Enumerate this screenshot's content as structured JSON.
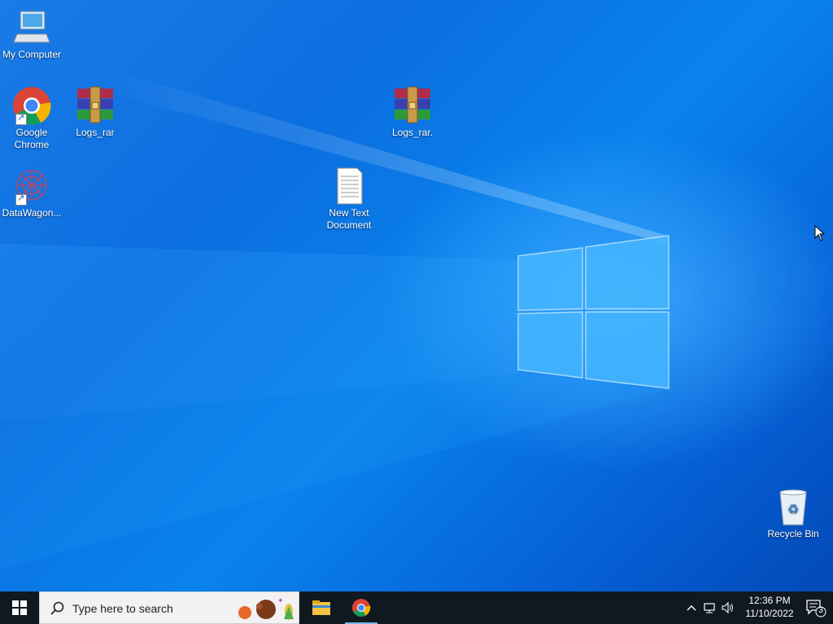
{
  "desktop": {
    "icons": [
      {
        "id": "my-computer",
        "label": "My Computer"
      },
      {
        "id": "google-chrome",
        "label": "Google Chrome"
      },
      {
        "id": "logs-rar-1",
        "label": "Logs_rar"
      },
      {
        "id": "logs-rar-2",
        "label": "Logs_rar."
      },
      {
        "id": "datawagon",
        "label": "DataWagon..."
      },
      {
        "id": "new-text-document",
        "label": "New Text Document"
      },
      {
        "id": "recycle-bin",
        "label": "Recycle Bin"
      }
    ]
  },
  "taskbar": {
    "search_placeholder": "Type here to search",
    "apps": [
      "File Explorer",
      "Google Chrome"
    ],
    "clock": {
      "time": "12:36 PM",
      "date": "11/10/2022"
    },
    "notifications_count": "3"
  },
  "colors": {
    "taskbar_bg": "#101820",
    "desktop_accent": "#0a82ec",
    "active_indicator": "#76b9ed"
  }
}
